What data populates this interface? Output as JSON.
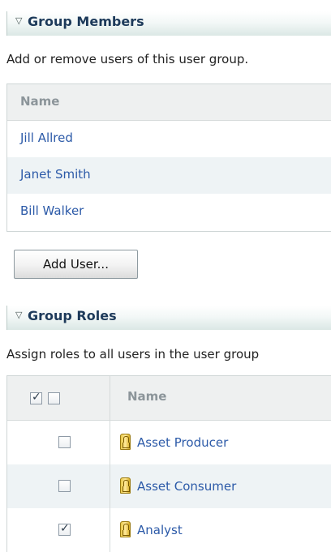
{
  "group_members": {
    "title": "Group Members",
    "description": "Add or remove users of this user group.",
    "column_name": "Name",
    "members": [
      "Jill Allred",
      "Janet Smith",
      "Bill Walker"
    ],
    "add_button": "Add User..."
  },
  "group_roles": {
    "title": "Group Roles",
    "description": "Assign roles to all users in the user group",
    "column_name": "Name",
    "select_all_checked": true,
    "roles": [
      {
        "name": "Asset Producer",
        "checked": false
      },
      {
        "name": "Asset Consumer",
        "checked": false
      },
      {
        "name": "Analyst",
        "checked": true
      }
    ]
  },
  "colors": {
    "link": "#2c5aa8",
    "header_title": "#1d3a5a",
    "row_alt": "#eef3f5"
  },
  "icons": {
    "collapse": "triangle-down-icon",
    "role": "role-icon"
  }
}
